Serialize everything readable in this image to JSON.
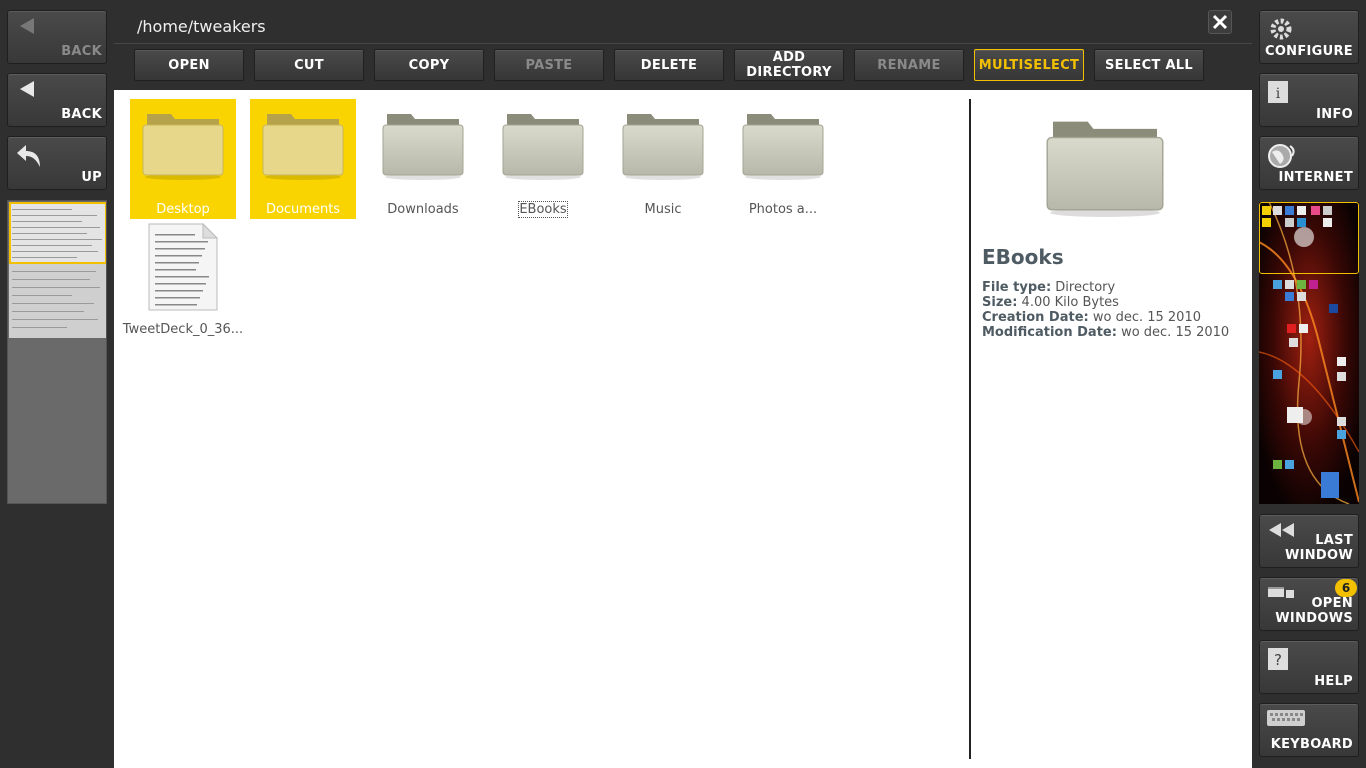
{
  "header": {
    "path": "/home/tweakers"
  },
  "left_sidebar": {
    "back_disabled_label": "BACK",
    "back_label": "BACK",
    "up_label": "UP"
  },
  "toolbar": {
    "open": "OPEN",
    "cut": "CUT",
    "copy": "COPY",
    "paste": "PASTE",
    "delete": "DELETE",
    "add_directory": "ADD\nDIRECTORY",
    "rename": "RENAME",
    "multiselect": "MULTISELECT",
    "select_all": "SELECT ALL"
  },
  "files": [
    {
      "name": "Desktop",
      "type": "folder",
      "selected": true
    },
    {
      "name": "Documents",
      "type": "folder",
      "selected": true
    },
    {
      "name": "Downloads",
      "type": "folder",
      "selected": false
    },
    {
      "name": "EBooks",
      "type": "folder",
      "selected": false,
      "focused": true
    },
    {
      "name": "Music",
      "type": "folder",
      "selected": false
    },
    {
      "name": "Photos a...",
      "type": "folder",
      "selected": false
    },
    {
      "name": "TweetDeck_0_36...",
      "type": "document",
      "selected": false
    }
  ],
  "preview": {
    "title": "EBooks",
    "file_type_label": "File type:",
    "file_type": "Directory",
    "size_label": "Size:",
    "size": "4.00 Kilo Bytes",
    "creation_label": "Creation Date:",
    "creation": "wo dec. 15 2010",
    "modification_label": "Modification Date:",
    "modification": "wo dec. 15 2010"
  },
  "right_sidebar": {
    "configure": "CONFIGURE",
    "info": "INFO",
    "internet": "INTERNET",
    "last_window": "LAST\nWINDOW",
    "open_windows": "OPEN\nWINDOWS",
    "open_windows_count": "6",
    "help": "HELP",
    "keyboard": "KEYBOARD"
  },
  "colors": {
    "accent": "#f3c000",
    "selection": "#f9d400",
    "background": "#2f2f2f"
  }
}
